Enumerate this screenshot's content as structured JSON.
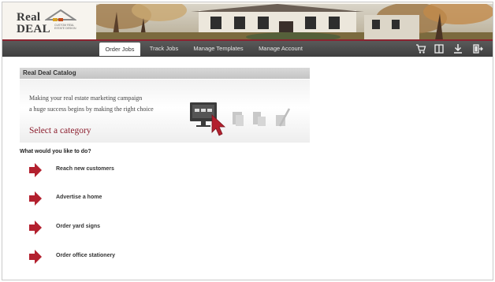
{
  "logo": {
    "line1": "Real",
    "line2": "DEAL",
    "tagline": "CUSTOM REAL ESTATE DESIGN"
  },
  "nav": {
    "items": [
      {
        "label": "Order Jobs",
        "active": true
      },
      {
        "label": "Track Jobs",
        "active": false
      },
      {
        "label": "Manage Templates",
        "active": false
      },
      {
        "label": "Manage Account",
        "active": false
      }
    ],
    "icons": [
      "cart-icon",
      "columns-icon",
      "download-icon",
      "exit-icon"
    ]
  },
  "catalog": {
    "title": "Real Deal Catalog",
    "line1": "Making your real estate marketing campaign",
    "line2": "a huge success begins by making the right choice",
    "cta": "Select a category"
  },
  "prompt": "What would you like to do?",
  "options": [
    {
      "label": "Reach new customers"
    },
    {
      "label": "Advertise a home"
    },
    {
      "label": "Order yard signs"
    },
    {
      "label": "Order office stationery"
    }
  ],
  "colors": {
    "accent": "#8b1c2c",
    "nav_bg": "#4a4a4a",
    "arrow": "#b3202e"
  }
}
